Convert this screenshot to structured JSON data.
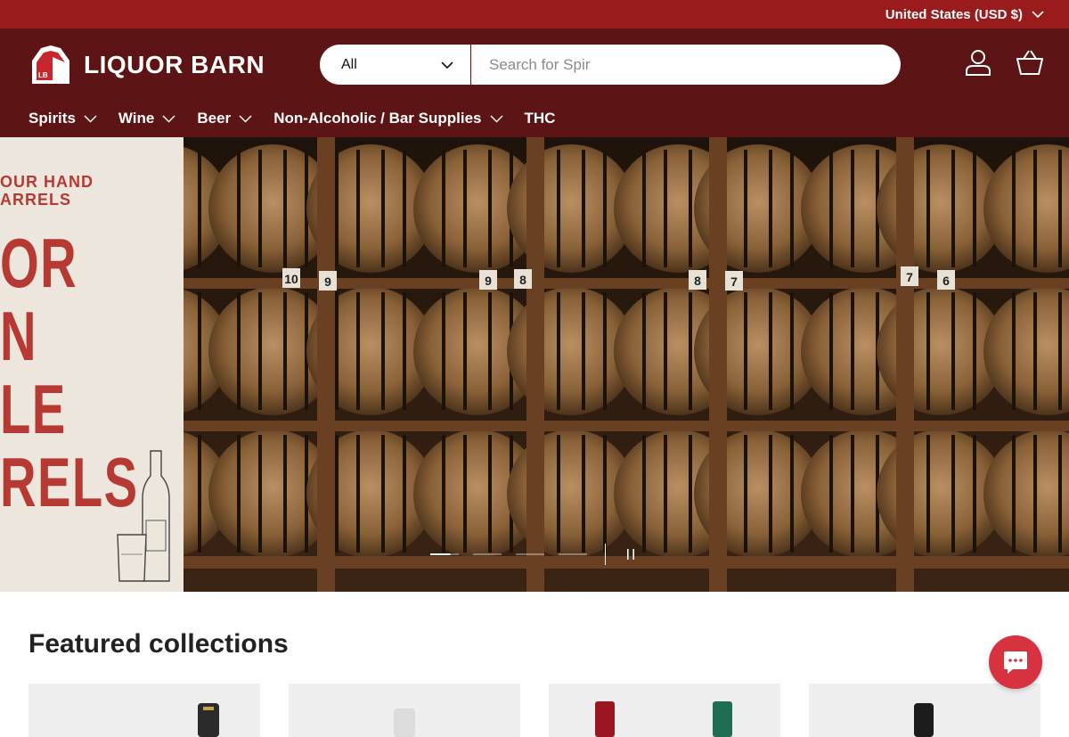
{
  "topbar": {
    "currency_label": "United States (USD $)"
  },
  "header": {
    "logo_text": "LIQUOR BARN",
    "logo_mark_text": "LB",
    "search": {
      "category_value": "All",
      "placeholder": "Search for Spir"
    },
    "icons": [
      "account-icon",
      "cart-icon"
    ]
  },
  "nav": {
    "items": [
      {
        "label": "Spirits",
        "has_dropdown": true
      },
      {
        "label": "Wine",
        "has_dropdown": true
      },
      {
        "label": "Beer",
        "has_dropdown": true
      },
      {
        "label": "Non-Alcoholic / Bar Supplies",
        "has_dropdown": true
      },
      {
        "label": "THC",
        "has_dropdown": false
      }
    ]
  },
  "hero": {
    "tag_lines": [
      "OUR HAND",
      "ARRELS"
    ],
    "big_lines": [
      "OR",
      "N",
      "LE",
      "RELS"
    ],
    "barrel_numbers": [
      "10",
      "9",
      "9",
      "8",
      "8",
      "7",
      "7",
      "6"
    ],
    "slides_total": 4,
    "active_slide": 1
  },
  "featured": {
    "title": "Featured collections",
    "card_count": 4
  },
  "colors": {
    "topbar": "#9a1b1b",
    "header": "#5d1414",
    "accent": "#b63a33",
    "chat": "#d6323f"
  }
}
